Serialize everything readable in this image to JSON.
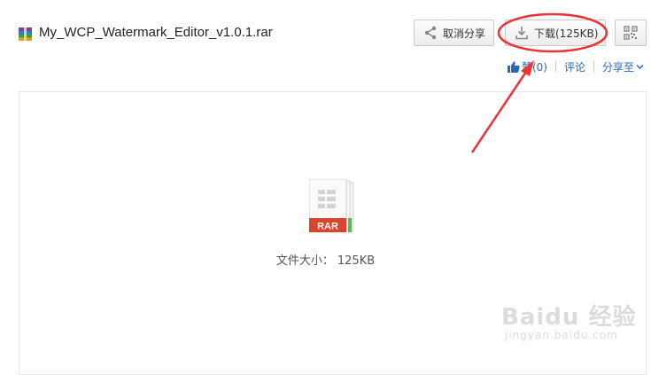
{
  "file": {
    "name": "My_WCP_Watermark_Editor_v1.0.1.rar",
    "icon": "rar-archive-icon"
  },
  "toolbar": {
    "share_label": "取消分享",
    "download_label": "下载(125KB)",
    "qr_icon": "qr-code-icon"
  },
  "actions": {
    "like_label": "赞(0)",
    "comment_label": "评论",
    "share_to_label": "分享至"
  },
  "preview": {
    "type_label": "RAR",
    "size_label": "文件大小：",
    "size_value": "125KB"
  },
  "watermark": {
    "brand": "Baidu 经验",
    "url": "jingyan.baidu.com"
  },
  "colors": {
    "link": "#2c68b6",
    "annotation": "#e8353a",
    "rar_label": "#d9442c"
  }
}
